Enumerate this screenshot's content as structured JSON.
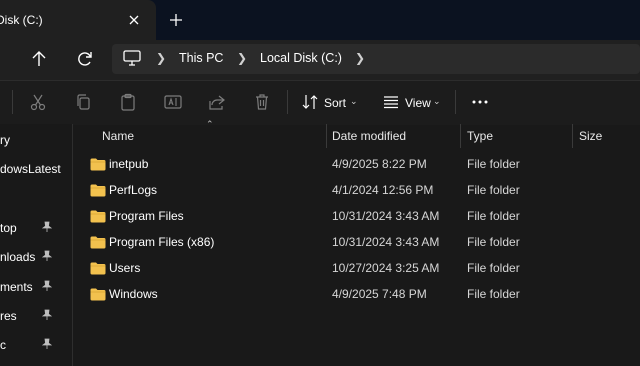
{
  "tab": {
    "title": "Disk (C:)"
  },
  "breadcrumb": {
    "items": [
      "This PC",
      "Local Disk (C:)"
    ]
  },
  "toolbar": {
    "sort_label": "Sort",
    "view_label": "View"
  },
  "sidebar": {
    "items": [
      {
        "label": "ry",
        "pinned": false
      },
      {
        "label": "dowsLatest",
        "pinned": false
      },
      {
        "label": "top",
        "pinned": true
      },
      {
        "label": "nloads",
        "pinned": true
      },
      {
        "label": "ments",
        "pinned": true
      },
      {
        "label": "res",
        "pinned": true
      },
      {
        "label": "c",
        "pinned": true
      }
    ]
  },
  "columns": {
    "name": "Name",
    "date": "Date modified",
    "type": "Type",
    "size": "Size"
  },
  "files": [
    {
      "name": "inetpub",
      "date": "4/9/2025 8:22 PM",
      "type": "File folder"
    },
    {
      "name": "PerfLogs",
      "date": "4/1/2024 12:56 PM",
      "type": "File folder"
    },
    {
      "name": "Program Files",
      "date": "10/31/2024 3:43 AM",
      "type": "File folder"
    },
    {
      "name": "Program Files (x86)",
      "date": "10/31/2024 3:43 AM",
      "type": "File folder"
    },
    {
      "name": "Users",
      "date": "10/27/2024 3:25 AM",
      "type": "File folder"
    },
    {
      "name": "Windows",
      "date": "4/9/2025 7:48 PM",
      "type": "File folder"
    }
  ],
  "colors": {
    "folder": "#f2c14e",
    "background": "#191919"
  }
}
